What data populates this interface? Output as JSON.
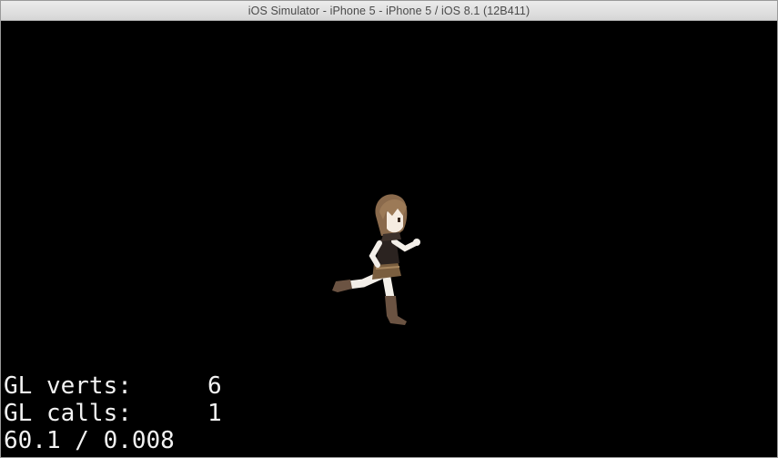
{
  "window": {
    "title": "iOS Simulator - iPhone 5 - iPhone 5 / iOS 8.1 (12B411)"
  },
  "scene": {
    "sprite": "running-girl-sprite"
  },
  "stats": {
    "verts_label": "GL verts:",
    "verts_value": "6",
    "calls_label": "GL calls:",
    "calls_value": "1",
    "fps_line": "60.1 / 0.008"
  },
  "colors": {
    "background": "#000000",
    "stats_text": "#f2f2f2",
    "titlebar": "#e2e2e2"
  }
}
